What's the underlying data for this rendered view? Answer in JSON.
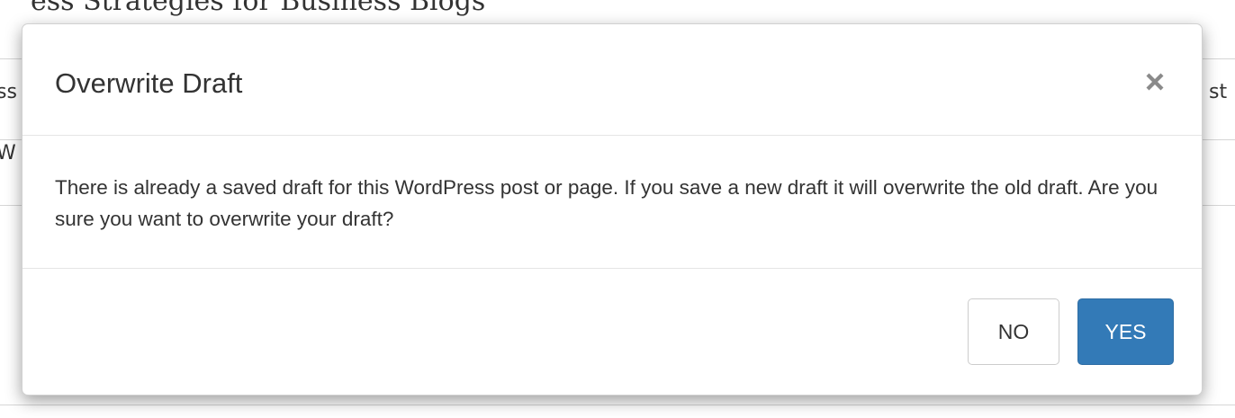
{
  "background": {
    "page_title_fragment": "ess Strategies for Business Blogs",
    "row1_left_fragment": "ss",
    "row1_right_fragment": "st",
    "row2_left_fragment": "W"
  },
  "modal": {
    "title": "Overwrite Draft",
    "close_symbol": "×",
    "message": "There is already a saved draft for this WordPress post or page. If you save a new draft it will overwrite the old draft. Are you sure you want to overwrite your draft?",
    "buttons": {
      "no_label": "NO",
      "yes_label": "YES"
    }
  },
  "colors": {
    "primary": "#337ab7",
    "text": "#333333",
    "divider": "#e5e5e5"
  },
  "icons": {
    "close": "close-icon"
  }
}
